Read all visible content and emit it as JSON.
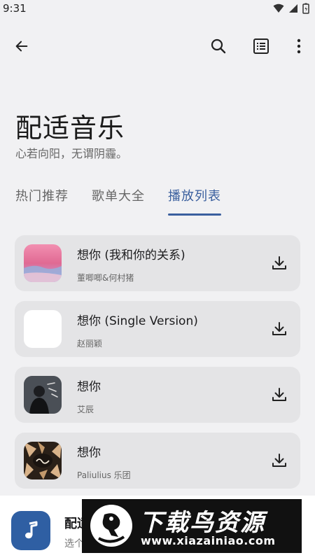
{
  "status_bar": {
    "time": "9:31"
  },
  "header": {
    "back_icon": "arrow-left-icon",
    "search_icon": "search-icon",
    "list_icon": "list-box-icon",
    "more_icon": "more-vertical-icon"
  },
  "page": {
    "title": "配适音乐",
    "subtitle": "心若向阳，无谓阴霾。"
  },
  "tabs": [
    {
      "label": "热门推荐",
      "active": false
    },
    {
      "label": "歌单大全",
      "active": false
    },
    {
      "label": "播放列表",
      "active": true
    }
  ],
  "songs": [
    {
      "title": "想你 (我和你的关系)",
      "artist": "董唧唧&何村猪"
    },
    {
      "title": "想你 (Single Version)",
      "artist": "赵丽颖"
    },
    {
      "title": "想你",
      "artist": "艾辰"
    },
    {
      "title": "想你",
      "artist": "Paliulius 乐团"
    }
  ],
  "player": {
    "title": "配适",
    "subtitle": "选个",
    "icon": "music-note-icon"
  },
  "watermark": {
    "title": "下载鸟资源",
    "url": "www.xiazainiao.com"
  },
  "colors": {
    "accent": "#3a5f9e",
    "card": "#e4e4e6",
    "background": "#f1f1f3"
  }
}
